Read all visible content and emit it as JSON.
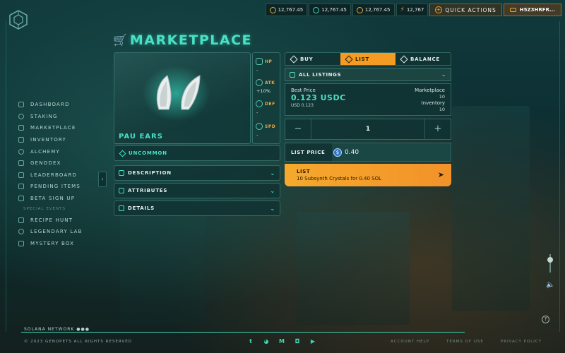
{
  "topbar": {
    "currencies": [
      {
        "icon": "coin-icon",
        "value": "12,767.45"
      },
      {
        "icon": "gem-icon",
        "value": "12,767.45"
      },
      {
        "icon": "coin-icon",
        "value": "12,767.45"
      },
      {
        "icon": "bolt-icon",
        "value": "12,767"
      }
    ],
    "quick_actions": "QUICK ACTIONS",
    "wallet": "H5Z3HRFR..."
  },
  "sidebar": {
    "items": [
      {
        "label": "DASHBOARD",
        "icon": "dashboard-icon"
      },
      {
        "label": "STAKING",
        "icon": "staking-icon"
      },
      {
        "label": "MARKETPLACE",
        "icon": "cart-icon"
      },
      {
        "label": "INVENTORY",
        "icon": "inventory-icon"
      },
      {
        "label": "ALCHEMY",
        "icon": "flask-icon"
      },
      {
        "label": "GENODEX",
        "icon": "genodex-icon"
      },
      {
        "label": "LEADERBOARD",
        "icon": "leaderboard-icon"
      },
      {
        "label": "PENDING ITEMS",
        "icon": "hourglass-icon"
      },
      {
        "label": "BETA SIGN UP",
        "icon": "beta-icon"
      }
    ],
    "special_label": "SPECIAL EVENTS",
    "special_items": [
      {
        "label": "RECIPE HUNT",
        "icon": "recipe-icon"
      },
      {
        "label": "LEGENDARY LAB",
        "icon": "lab-icon"
      },
      {
        "label": "MYSTERY BOX",
        "icon": "box-icon"
      }
    ]
  },
  "page": {
    "title": "MARKETPLACE"
  },
  "item": {
    "name": "PAU EARS",
    "rarity": "UNCOMMON",
    "stats": [
      {
        "label": "HP",
        "value": "-"
      },
      {
        "label": "ATK",
        "value": "+10%"
      },
      {
        "label": "DEF",
        "value": "-"
      },
      {
        "label": "SPD",
        "value": "-"
      }
    ],
    "sections": [
      "DESCRIPTION",
      "ATTRIBUTES",
      "DETAILS"
    ]
  },
  "trade": {
    "tabs": [
      {
        "label": "BUY",
        "active": false
      },
      {
        "label": "LIST",
        "active": true
      },
      {
        "label": "BALANCE",
        "active": false
      }
    ],
    "listings_label": "ALL LISTINGS",
    "best_price_label": "Best Price",
    "best_price": "0.123 USDC",
    "usd": "USD 0.123",
    "marketplace_label": "Marketplace",
    "marketplace_value": "10",
    "inventory_label": "Inventory",
    "inventory_value": "10",
    "quantity": "1",
    "minus": "−",
    "plus": "+",
    "list_price_label": "LIST PRICE",
    "list_price_value": "0.40",
    "list_button_title": "LIST",
    "list_button_desc": "10 Subsynth Crystals for 0.40 SOL"
  },
  "footer": {
    "network": "SOLANA NETWORK ●●●",
    "copyright": "© 2023 GENOPETS ALL RIGHTS RESERVED",
    "socials": [
      "twitter-icon",
      "discord-icon",
      "medium-icon",
      "instagram-icon",
      "youtube-icon"
    ],
    "links": [
      "ACCOUNT HELP",
      "TERMS OF USE",
      "PRIVACY POLICY"
    ]
  },
  "colors": {
    "accent": "#46e0c4",
    "orange": "#f39b22",
    "panel": "#10322f"
  }
}
